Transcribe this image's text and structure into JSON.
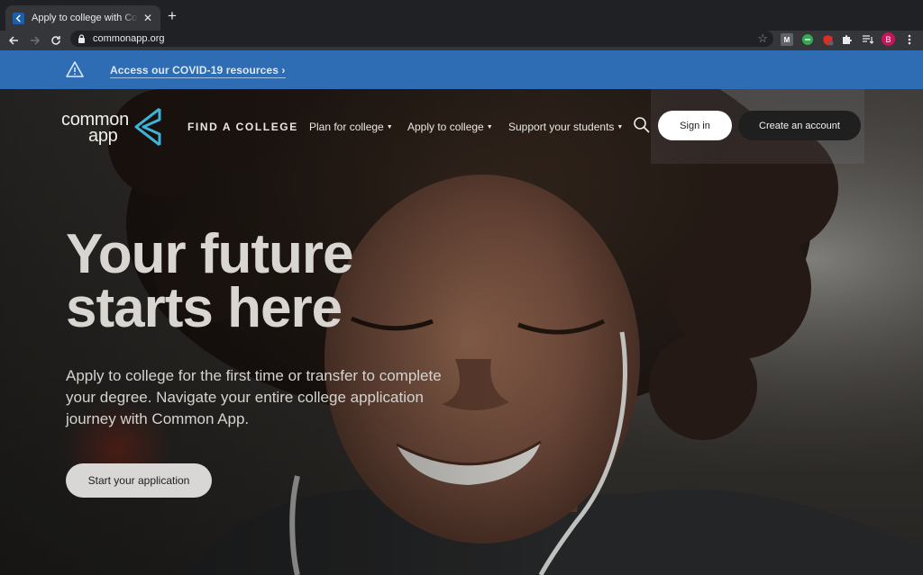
{
  "browser": {
    "tab_title": "Apply to college with Common App",
    "tab_close": "✕",
    "new_tab": "+",
    "url": "commonapp.org",
    "profile_initial": "B",
    "extension_badge": "M"
  },
  "alert": {
    "link_text": "Access our COVID-19 resources ›"
  },
  "header": {
    "logo_line1": "common",
    "logo_line2": "app",
    "nav": [
      {
        "label": "FIND A COLLEGE"
      },
      {
        "label": "Plan for college"
      },
      {
        "label": "Apply to college"
      },
      {
        "label": "Support your students"
      }
    ],
    "caret": "▼",
    "sign_in": "Sign in",
    "create_account": "Create an account"
  },
  "hero": {
    "headline_line1": "Your future",
    "headline_line2": "starts here",
    "subtext": "Apply to college for the first time or transfer to complete your degree. Navigate your entire college application journey with Common App.",
    "cta": "Start your application"
  },
  "colors": {
    "banner_blue": "#2e6db4",
    "logo_teal": "#3db3d8"
  }
}
